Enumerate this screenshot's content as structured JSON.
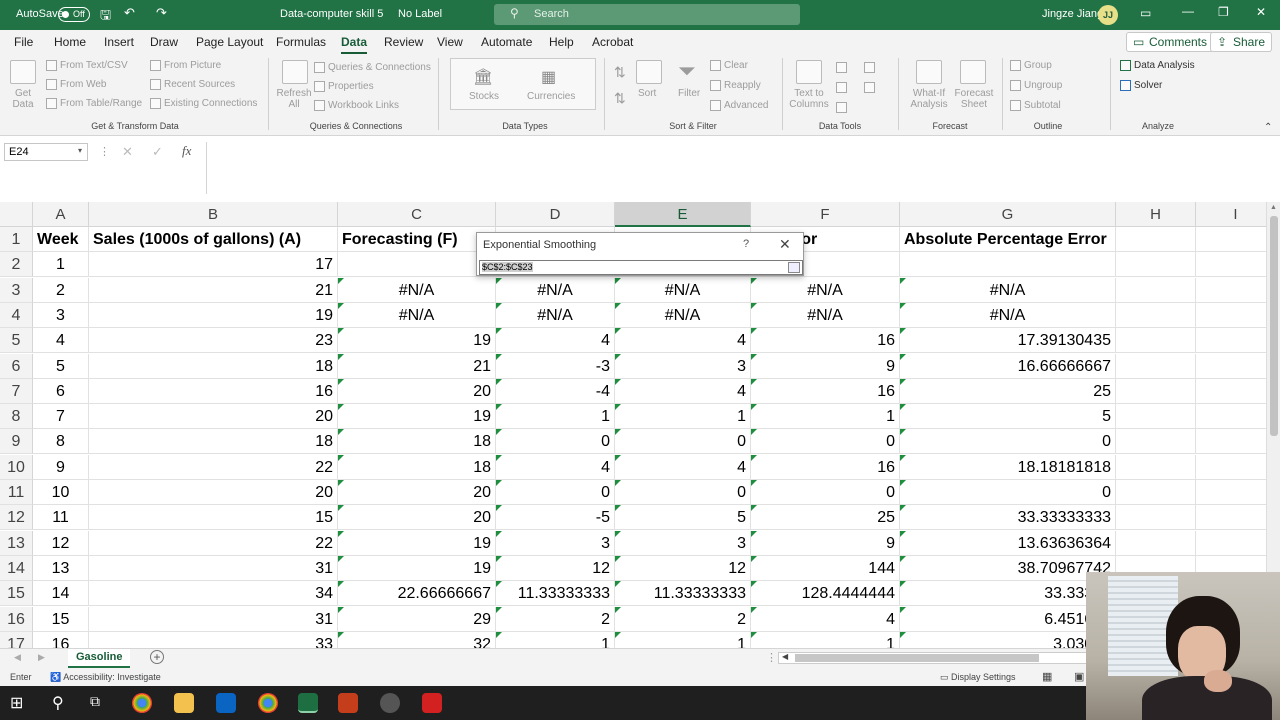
{
  "titlebar": {
    "autosave_label": "AutoSave",
    "autosave_state": "Off",
    "filename": "Data-computer skill 5",
    "label": "No Label",
    "search_placeholder": "Search",
    "user_name": "Jingze Jiang",
    "user_initials": "JJ"
  },
  "menu": {
    "tabs": [
      "File",
      "Home",
      "Insert",
      "Draw",
      "Page Layout",
      "Formulas",
      "Data",
      "Review",
      "View",
      "Automate",
      "Help",
      "Acrobat"
    ],
    "active": "Data",
    "comments_label": "Comments",
    "share_label": "Share"
  },
  "ribbon": {
    "get_data": "Get Data",
    "get_transform": [
      "From Text/CSV",
      "From Web",
      "From Table/Range",
      "From Picture",
      "Recent Sources",
      "Existing Connections"
    ],
    "group_get_transform": "Get & Transform Data",
    "refresh_all": "Refresh All",
    "queries": [
      "Queries & Connections",
      "Properties",
      "Workbook Links"
    ],
    "group_queries": "Queries & Connections",
    "stocks": "Stocks",
    "currencies": "Currencies",
    "group_data_types": "Data Types",
    "sort": "Sort",
    "filter": "Filter",
    "filter_items": [
      "Clear",
      "Reapply",
      "Advanced"
    ],
    "group_sort_filter": "Sort & Filter",
    "text_to_columns": "Text to Columns",
    "group_data_tools": "Data Tools",
    "what_if": "What-If Analysis",
    "forecast_sheet": "Forecast Sheet",
    "group_forecast": "Forecast",
    "outline": [
      "Group",
      "Ungroup",
      "Subtotal"
    ],
    "group_outline": "Outline",
    "analyze": [
      "Data Analysis",
      "Solver"
    ],
    "group_analyze": "Analyze"
  },
  "formula_bar": {
    "name_box": "E24",
    "fx": "fx"
  },
  "columns": [
    "A",
    "B",
    "C",
    "D",
    "E",
    "F",
    "G",
    "H",
    "I"
  ],
  "selected_column": "E",
  "rows": [
    {
      "n": "1",
      "cells": [
        "Week",
        "Sales (1000s of gallons) (A)",
        "Forecasting (F)",
        "",
        "",
        "ed Error",
        "Absolute Percentage Error",
        "",
        ""
      ]
    },
    {
      "n": "2",
      "cells": [
        "1",
        "17",
        "",
        "",
        "",
        "",
        "",
        "",
        ""
      ]
    },
    {
      "n": "3",
      "cells": [
        "2",
        "21",
        "#N/A",
        "#N/A",
        "#N/A",
        "#N/A",
        "#N/A",
        "",
        ""
      ]
    },
    {
      "n": "4",
      "cells": [
        "3",
        "19",
        "#N/A",
        "#N/A",
        "#N/A",
        "#N/A",
        "#N/A",
        "",
        ""
      ]
    },
    {
      "n": "5",
      "cells": [
        "4",
        "23",
        "19",
        "4",
        "4",
        "16",
        "17.39130435",
        "",
        ""
      ]
    },
    {
      "n": "6",
      "cells": [
        "5",
        "18",
        "21",
        "-3",
        "3",
        "9",
        "16.66666667",
        "",
        ""
      ]
    },
    {
      "n": "7",
      "cells": [
        "6",
        "16",
        "20",
        "-4",
        "4",
        "16",
        "25",
        "",
        ""
      ]
    },
    {
      "n": "8",
      "cells": [
        "7",
        "20",
        "19",
        "1",
        "1",
        "1",
        "5",
        "",
        ""
      ]
    },
    {
      "n": "9",
      "cells": [
        "8",
        "18",
        "18",
        "0",
        "0",
        "0",
        "0",
        "",
        ""
      ]
    },
    {
      "n": "10",
      "cells": [
        "9",
        "22",
        "18",
        "4",
        "4",
        "16",
        "18.18181818",
        "",
        ""
      ]
    },
    {
      "n": "11",
      "cells": [
        "10",
        "20",
        "20",
        "0",
        "0",
        "0",
        "0",
        "",
        ""
      ]
    },
    {
      "n": "12",
      "cells": [
        "11",
        "15",
        "20",
        "-5",
        "5",
        "25",
        "33.33333333",
        "",
        ""
      ]
    },
    {
      "n": "13",
      "cells": [
        "12",
        "22",
        "19",
        "3",
        "3",
        "9",
        "13.63636364",
        "",
        ""
      ]
    },
    {
      "n": "14",
      "cells": [
        "13",
        "31",
        "19",
        "12",
        "12",
        "144",
        "38.70967742",
        "",
        ""
      ]
    },
    {
      "n": "15",
      "cells": [
        "14",
        "34",
        "22.66666667",
        "11.33333333",
        "11.33333333",
        "128.4444444",
        "33.33333",
        "",
        ""
      ]
    },
    {
      "n": "16",
      "cells": [
        "15",
        "31",
        "29",
        "2",
        "2",
        "4",
        "6.451612",
        "",
        ""
      ]
    },
    {
      "n": "17",
      "cells": [
        "16",
        "33",
        "32",
        "1",
        "1",
        "1",
        "3.03030",
        "",
        ""
      ]
    }
  ],
  "dialog": {
    "title": "Exponential Smoothing",
    "help": "?",
    "close": "✕",
    "input_value": "$C$2:$C$23"
  },
  "sheet_tab": "Gasoline",
  "status": {
    "mode": "Enter",
    "accessibility": "Accessibility: Investigate",
    "display_settings": "Display Settings"
  },
  "colors": {
    "excel_green": "#217346",
    "accent_dark": "#185c37"
  }
}
